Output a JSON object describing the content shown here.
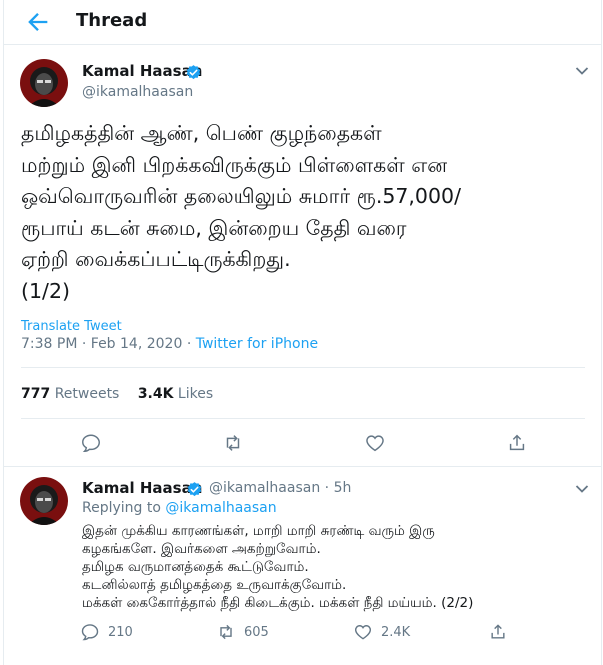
{
  "header": {
    "title": "Thread"
  },
  "main_tweet": {
    "name": "Kamal Haasan",
    "handle": "@ikamalhaasan",
    "text_lines": [
      "தமிழகத்தின் ஆண், பெண் குழந்தைகள்",
      "மற்றும் இனி பிறக்கவிருக்கும் பிள்ளைகள் என",
      "ஒவ்வொருவரின் தலையிலும் சுமார் ரூ.57,000/",
      "ரூபாய் கடன் சுமை, இன்றைய தேதி வரை",
      "ஏற்றி வைக்கப்பட்டிருக்கிறது.",
      "(1/2)"
    ],
    "translate": "Translate Tweet",
    "time": "7:38 PM",
    "date": "Feb 14, 2020",
    "dot": "·",
    "source": "Twitter for iPhone",
    "retweets_count": "777",
    "retweets_label": "Retweets",
    "likes_count": "3.4K",
    "likes_label": "Likes"
  },
  "reply_tweet": {
    "name": "Kamal Haasan",
    "handle": "@ikamalhaasan",
    "age": "· 5h",
    "replying_prefix": "Replying to",
    "replying_handle": "@ikamalhaasan",
    "text_lines": [
      "இதன் முக்கிய காரணங்கள், மாறி மாறி சுரண்டி வரும் இரு",
      "கழகங்களே.  இவர்களை அகற்றுவோம்.",
      "தமிழக வருமானத்தைக் கூட்டுவோம்.",
      "கடனில்லாத் தமிழகத்தை உருவாக்குவோம்.",
      "மக்கள் கைகோர்த்தால் நீதி கிடைக்கும். மக்கள் நீதி மய்யம். (2/2)"
    ],
    "reply_count": "210",
    "retweet_count": "605",
    "like_count": "2.4K"
  },
  "colors": {
    "accent": "#1da1f2",
    "muted": "#657786",
    "text": "#14171a",
    "border": "#e6ecf0"
  },
  "icons": [
    "back-arrow-icon",
    "verified-badge-icon",
    "chevron-down-icon",
    "reply-icon",
    "retweet-icon",
    "like-icon",
    "share-icon"
  ]
}
